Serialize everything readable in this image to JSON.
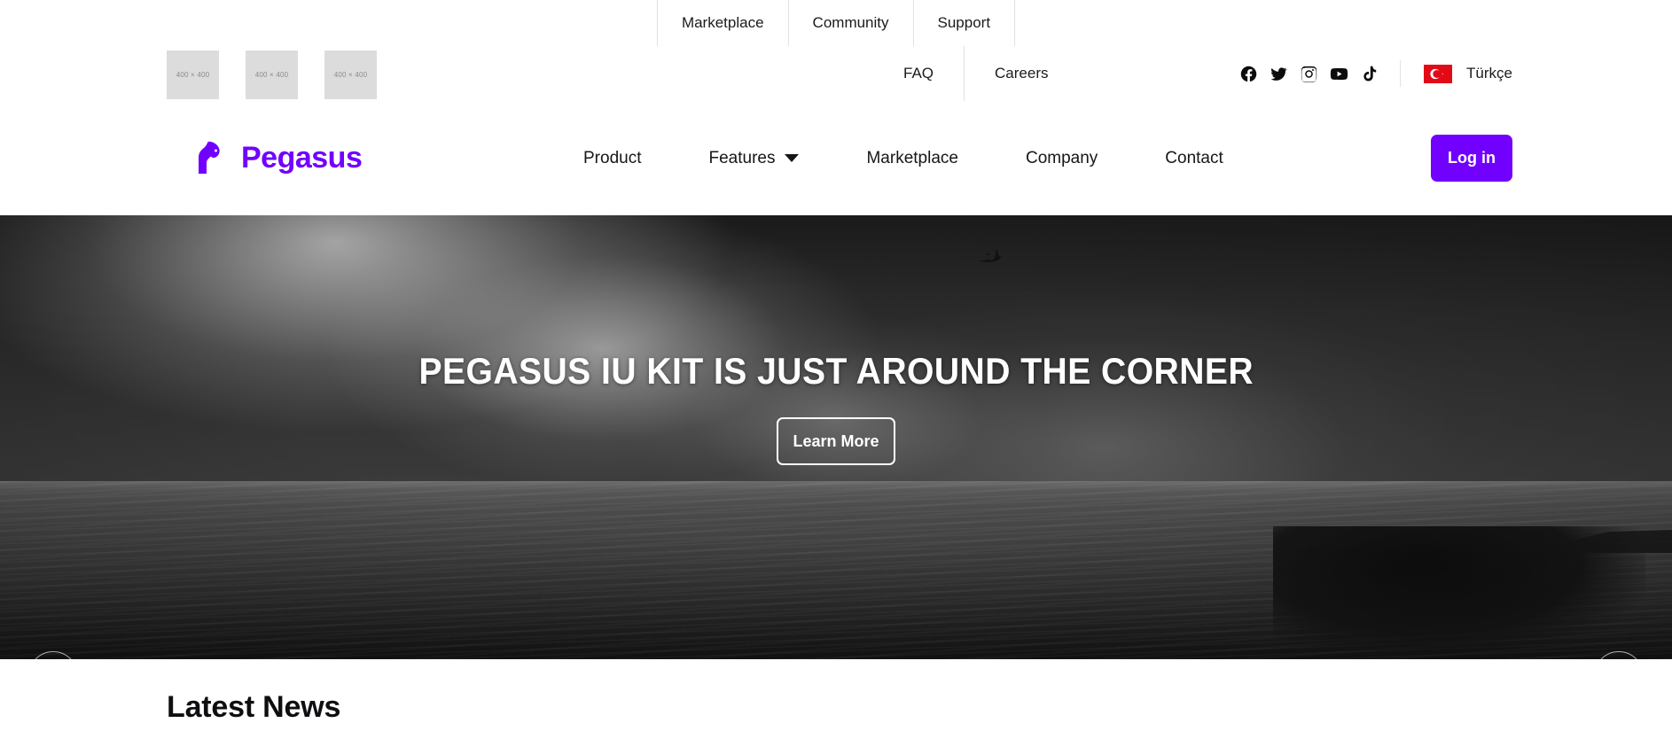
{
  "topbar": {
    "links": [
      {
        "label": "Marketplace",
        "name": "topbar-link-marketplace"
      },
      {
        "label": "Community",
        "name": "topbar-link-community"
      },
      {
        "label": "Support",
        "name": "topbar-link-support"
      }
    ]
  },
  "secondbar": {
    "placeholders": [
      {
        "label": "400 × 400"
      },
      {
        "label": "400 × 400"
      },
      {
        "label": "400 × 400"
      }
    ],
    "links": [
      {
        "label": "FAQ",
        "name": "secondbar-link-faq"
      },
      {
        "label": "Careers",
        "name": "secondbar-link-careers"
      }
    ],
    "socials": [
      {
        "icon": "facebook-icon",
        "label": "Facebook"
      },
      {
        "icon": "twitter-icon",
        "label": "Twitter"
      },
      {
        "icon": "instagram-icon",
        "label": "Instagram"
      },
      {
        "icon": "youtube-icon",
        "label": "YouTube"
      },
      {
        "icon": "tiktok-icon",
        "label": "TikTok"
      }
    ],
    "language": {
      "flag": "turkey-flag-icon",
      "label": "Türkçe"
    }
  },
  "brand": {
    "name": "Pegasus",
    "logo_icon": "pegasus-horse-logo-icon",
    "color": "#7200ff"
  },
  "nav": {
    "items": [
      {
        "label": "Product",
        "name": "nav-item-product",
        "has_dropdown": false
      },
      {
        "label": "Features",
        "name": "nav-item-features",
        "has_dropdown": true
      },
      {
        "label": "Marketplace",
        "name": "nav-item-marketplace",
        "has_dropdown": false
      },
      {
        "label": "Company",
        "name": "nav-item-company",
        "has_dropdown": false
      },
      {
        "label": "Contact",
        "name": "nav-item-contact",
        "has_dropdown": false
      }
    ],
    "login_label": "Log in",
    "login_color": "#7200ff"
  },
  "hero": {
    "title": "PEGASUS IU KIT IS JUST AROUND THE CORNER",
    "cta_label": "Learn More",
    "prev_label": "‹",
    "next_label": "›",
    "background_description": "grayscale stormy seascape with flying bird"
  },
  "news": {
    "title": "Latest News"
  }
}
